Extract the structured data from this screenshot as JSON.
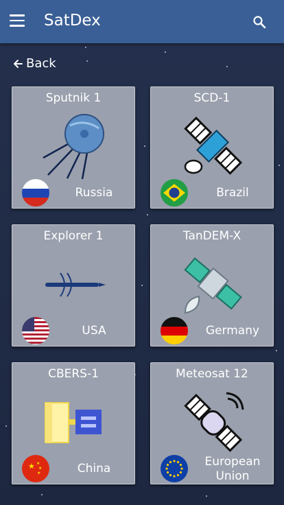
{
  "app": {
    "title": "SatDex"
  },
  "nav": {
    "back_label": "Back"
  },
  "icons": {
    "menu": "menu-icon",
    "search": "search-icon",
    "back": "arrow-left-icon"
  },
  "satellites": [
    {
      "name": "Sputnik 1",
      "country": "Russia",
      "flag": "flag-russia"
    },
    {
      "name": "SCD-1",
      "country": "Brazil",
      "flag": "flag-brazil"
    },
    {
      "name": "Explorer 1",
      "country": "USA",
      "flag": "flag-usa"
    },
    {
      "name": "TanDEM-X",
      "country": "Germany",
      "flag": "flag-germany"
    },
    {
      "name": "CBERS-1",
      "country": "China",
      "flag": "flag-china"
    },
    {
      "name": "Meteosat 12",
      "country": "European Union",
      "flag": "flag-eu"
    }
  ],
  "colors": {
    "appbar": "#3a5f96",
    "background": "#1f2a44",
    "card": "#9aa0ad"
  }
}
